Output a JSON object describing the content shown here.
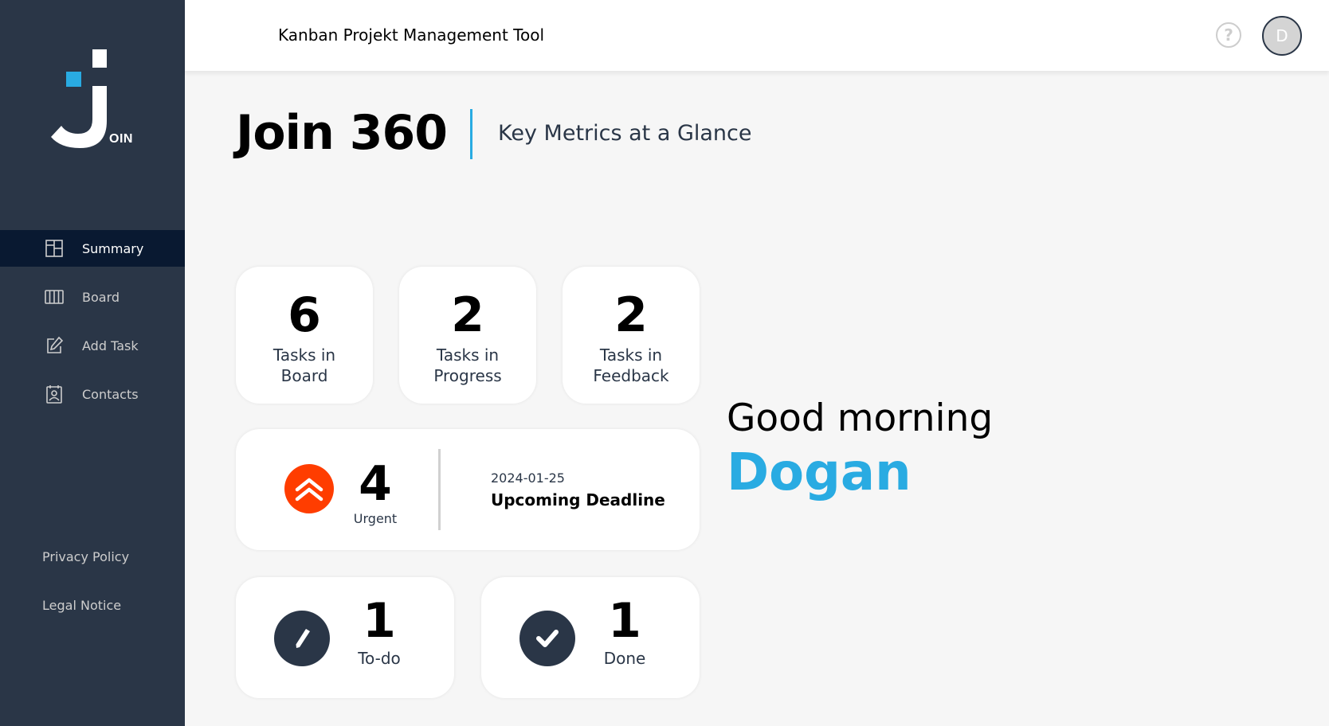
{
  "app": {
    "title": "Kanban Projekt Management Tool",
    "logo_text": "OIN",
    "avatar_initial": "D",
    "help_symbol": "?"
  },
  "sidebar": {
    "items": [
      {
        "label": "Summary",
        "icon": "summary-icon",
        "active": true
      },
      {
        "label": "Board",
        "icon": "board-icon",
        "active": false
      },
      {
        "label": "Add Task",
        "icon": "add-task-icon",
        "active": false
      },
      {
        "label": "Contacts",
        "icon": "contacts-icon",
        "active": false
      }
    ],
    "footer": [
      {
        "label": "Privacy Policy"
      },
      {
        "label": "Legal Notice"
      }
    ]
  },
  "page": {
    "title": "Join 360",
    "subtitle": "Key Metrics at a Glance"
  },
  "metrics": {
    "board": {
      "value": "6",
      "label": "Tasks in Board"
    },
    "progress": {
      "value": "2",
      "label": "Tasks in Progress"
    },
    "feedback": {
      "value": "2",
      "label": "Tasks in Feedback"
    },
    "urgent": {
      "value": "4",
      "label": "Urgent",
      "icon": "double-chevron-up-icon"
    },
    "deadline": {
      "date": "2024-01-25",
      "label": "Upcoming Deadline"
    },
    "todo": {
      "value": "1",
      "label": "To-do",
      "icon": "pencil-icon"
    },
    "done": {
      "value": "1",
      "label": "Done",
      "icon": "checkmark-icon"
    }
  },
  "greeting": {
    "text": "Good morning",
    "name": "Dogan"
  },
  "colors": {
    "sidebar": "#2a3647",
    "sidebar_active": "#091931",
    "accent": "#29abe2",
    "urgent": "#ff3d00"
  }
}
